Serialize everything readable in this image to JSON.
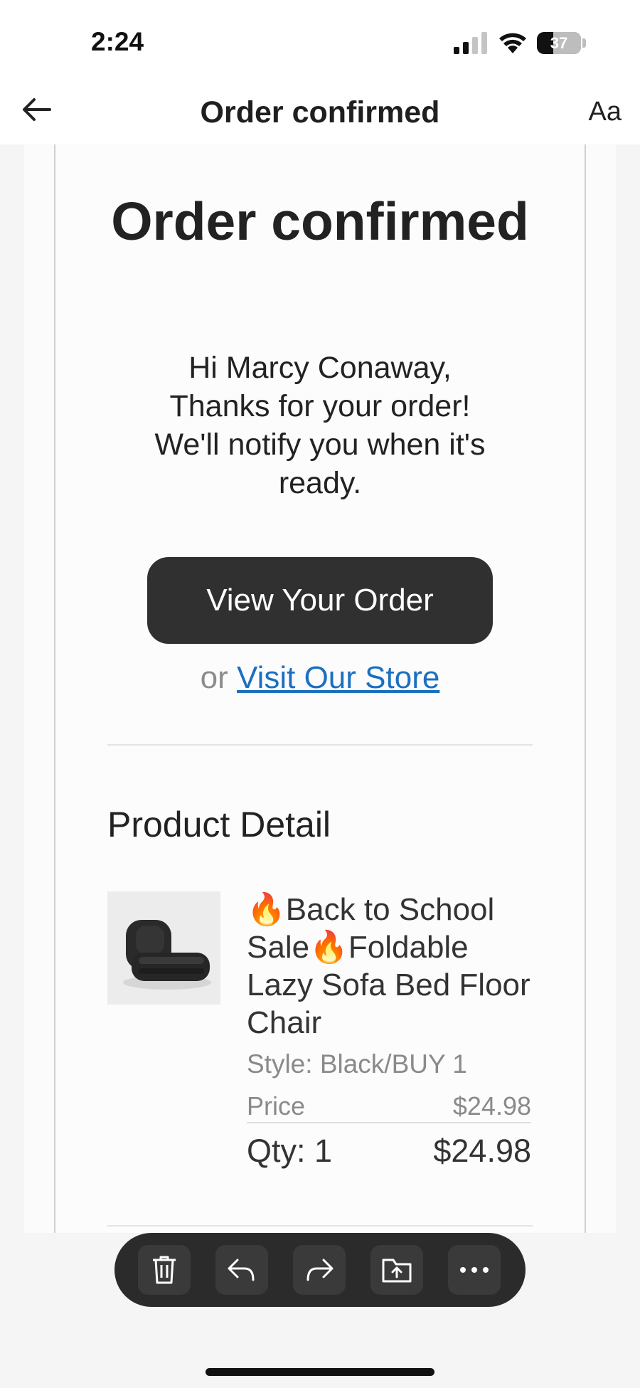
{
  "status_bar": {
    "time": "2:24",
    "battery_level": "37",
    "battery_fraction": 0.37
  },
  "nav": {
    "title": "Order confirmed",
    "font_button_label": "Aa",
    "icons": [
      "back-arrow-icon"
    ]
  },
  "email": {
    "headline": "Order confirmed",
    "greeting_lines": [
      "Hi Marcy Conaway,",
      "Thanks for your order!",
      "We'll notify you when it's ready."
    ],
    "view_order_button": "View Your Order",
    "alt_prefix": "or",
    "store_link": "Visit Our Store",
    "section_title": "Product Detail",
    "product": {
      "fire_emoji": "🔥",
      "name_part1": "Back to School Sale",
      "name_part2": "Foldable Lazy Sofa Bed Floor Chair",
      "style": "Style: Black/BUY 1",
      "price_label": "Price",
      "price_value": "$24.98",
      "qty_label": "Qty: 1",
      "total_value": "$24.98"
    }
  },
  "toolbar": {
    "buttons": [
      "trash-icon",
      "reply-icon",
      "forward-icon",
      "move-to-folder-icon",
      "more-icon"
    ]
  },
  "colors": {
    "button_dark": "#303030",
    "link_blue": "#1c6fc1",
    "toolbar_bg": "#2b2b2b"
  }
}
